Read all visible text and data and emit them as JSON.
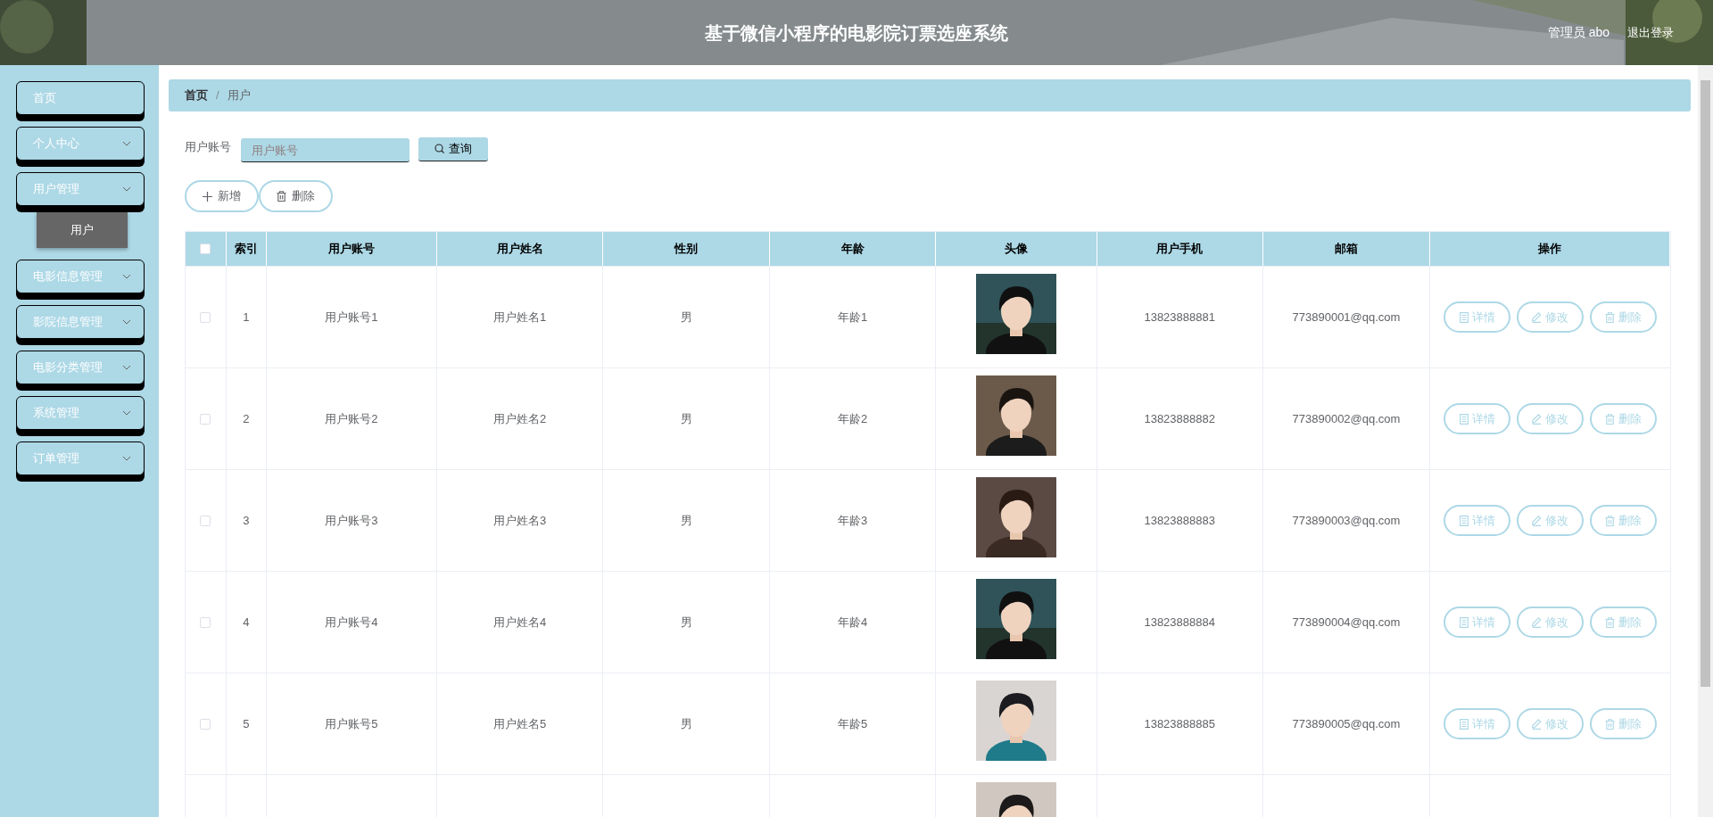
{
  "header": {
    "title": "基于微信小程序的电影院订票选座系统",
    "user": "管理员 abo",
    "logout": "退出登录"
  },
  "sidebar": {
    "items": [
      {
        "label": "首页",
        "kind": "link"
      },
      {
        "label": "个人中心",
        "kind": "submenu"
      },
      {
        "label": "用户管理",
        "kind": "submenu",
        "expanded": true,
        "children": [
          {
            "label": "用户",
            "selected": true
          }
        ]
      },
      {
        "label": "电影信息管理",
        "kind": "submenu"
      },
      {
        "label": "影院信息管理",
        "kind": "submenu"
      },
      {
        "label": "电影分类管理",
        "kind": "submenu"
      },
      {
        "label": "系统管理",
        "kind": "submenu"
      },
      {
        "label": "订单管理",
        "kind": "submenu"
      }
    ]
  },
  "breadcrumb": {
    "items": [
      "首页",
      "用户"
    ],
    "separator": "/"
  },
  "search": {
    "label": "用户账号",
    "placeholder": "用户账号",
    "button": "查询"
  },
  "toolbar": [
    {
      "label": "新增",
      "kind": "add"
    },
    {
      "label": "删除",
      "kind": "delete"
    }
  ],
  "table": {
    "select_all": {
      "checked": false
    },
    "columns": [
      "索引",
      "用户账号",
      "用户姓名",
      "性别",
      "年龄",
      "头像",
      "用户手机",
      "邮箱",
      "操作"
    ],
    "rows": [
      {
        "selected": false,
        "index": "1",
        "account": "用户账号1",
        "name": "用户姓名1",
        "gender": "男",
        "age": "年龄1",
        "avatar": {
          "kind": "picture"
        },
        "phone": "13823888881",
        "email": "773890001@qq.com",
        "actions": [
          {
            "label": "详情",
            "kind": "detail"
          },
          {
            "label": "修改",
            "kind": "edit"
          },
          {
            "label": "删除",
            "kind": "delete"
          }
        ]
      },
      {
        "selected": false,
        "index": "2",
        "account": "用户账号2",
        "name": "用户姓名2",
        "gender": "男",
        "age": "年龄2",
        "avatar": {
          "kind": "picture"
        },
        "phone": "13823888882",
        "email": "773890002@qq.com",
        "actions": [
          {
            "label": "详情",
            "kind": "detail"
          },
          {
            "label": "修改",
            "kind": "edit"
          },
          {
            "label": "删除",
            "kind": "delete"
          }
        ]
      },
      {
        "selected": false,
        "index": "3",
        "account": "用户账号3",
        "name": "用户姓名3",
        "gender": "男",
        "age": "年龄3",
        "avatar": {
          "kind": "picture"
        },
        "phone": "13823888883",
        "email": "773890003@qq.com",
        "actions": [
          {
            "label": "详情",
            "kind": "detail"
          },
          {
            "label": "修改",
            "kind": "edit"
          },
          {
            "label": "删除",
            "kind": "delete"
          }
        ]
      },
      {
        "selected": false,
        "index": "4",
        "account": "用户账号4",
        "name": "用户姓名4",
        "gender": "男",
        "age": "年龄4",
        "avatar": {
          "kind": "picture"
        },
        "phone": "13823888884",
        "email": "773890004@qq.com",
        "actions": [
          {
            "label": "详情",
            "kind": "detail"
          },
          {
            "label": "修改",
            "kind": "edit"
          },
          {
            "label": "删除",
            "kind": "delete"
          }
        ]
      },
      {
        "selected": false,
        "index": "5",
        "account": "用户账号5",
        "name": "用户姓名5",
        "gender": "男",
        "age": "年龄5",
        "avatar": {
          "kind": "picture"
        },
        "phone": "13823888885",
        "email": "773890005@qq.com",
        "actions": [
          {
            "label": "详情",
            "kind": "detail"
          },
          {
            "label": "修改",
            "kind": "edit"
          },
          {
            "label": "删除",
            "kind": "delete"
          }
        ]
      },
      {
        "avatar": {
          "kind": "picture"
        }
      }
    ]
  }
}
